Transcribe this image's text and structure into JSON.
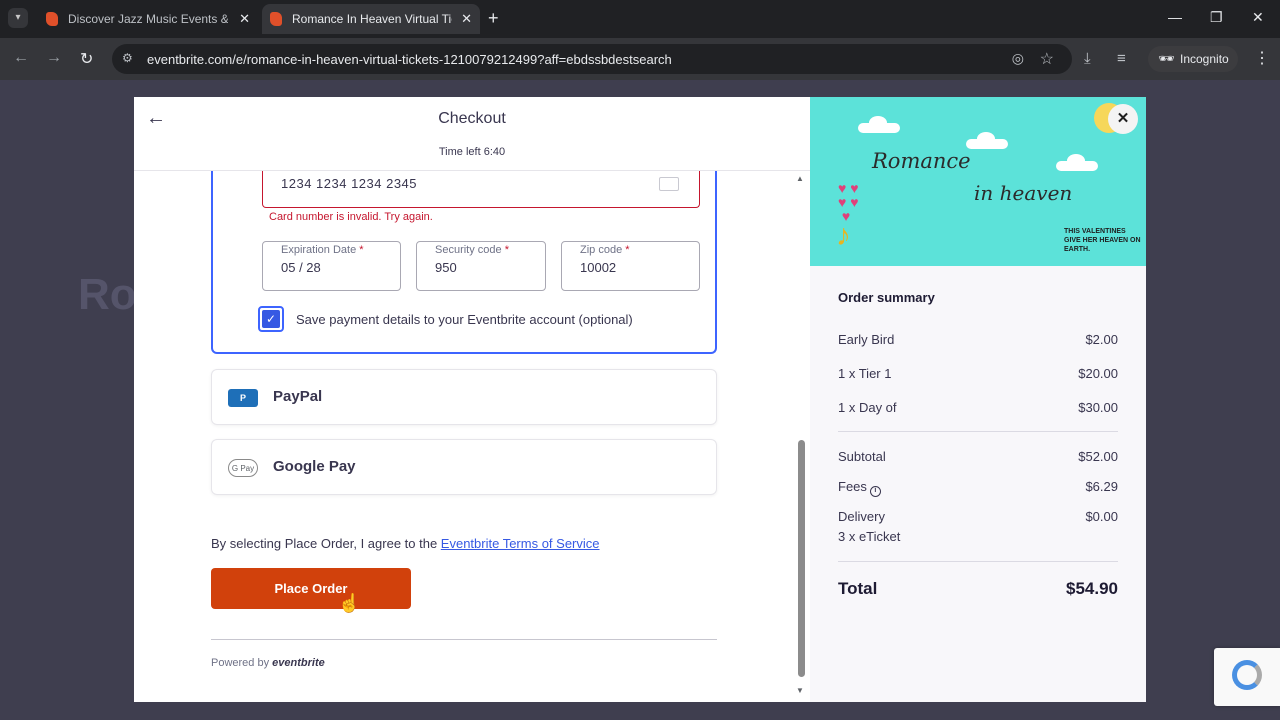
{
  "browser": {
    "tabs": [
      {
        "title": "Discover Jazz Music Events & A"
      },
      {
        "title": "Romance In Heaven Virtual Tick"
      }
    ],
    "url": "eventbrite.com/e/romance-in-heaven-virtual-tickets-1210079212499?aff=ebdssbdestsearch",
    "profile_label": "Incognito"
  },
  "checkout": {
    "title": "Checkout",
    "time_left": "Time left 6:40",
    "card_number": "1234  1234  1234  2345",
    "card_error": "Card number is invalid. Try again.",
    "expiration_label": "Expiration Date",
    "expiration_value": "05  /  28",
    "security_label": "Security code",
    "security_value": "950",
    "zip_label": "Zip code",
    "zip_value": "10002",
    "required_mark": "*",
    "save_label": "Save payment details to your Eventbrite account (optional)",
    "save_checked": true,
    "paypal_icon_text": "P",
    "paypal_label": "PayPal",
    "gpay_icon_text": "G Pay",
    "gpay_label": "Google Pay",
    "agree_text": "By selecting Place Order, I agree to the ",
    "agree_link": "Eventbrite Terms of Service",
    "place_order": "Place Order",
    "powered_by": "Powered by",
    "powered_brand": "eventbrite"
  },
  "banner": {
    "line1": "Romance",
    "line2": "in heaven",
    "tagline": "THIS VALENTINES GIVE HER HEAVEN ON EARTH."
  },
  "summary": {
    "title": "Order summary",
    "items": [
      {
        "label": "Early Bird",
        "amount": "$2.00"
      },
      {
        "label": "1 x Tier 1",
        "amount": "$20.00"
      },
      {
        "label": "1 x Day of",
        "amount": "$30.00"
      }
    ],
    "subtotal_label": "Subtotal",
    "subtotal": "$52.00",
    "fees_label": "Fees",
    "fees": "$6.29",
    "delivery_label": "Delivery",
    "delivery_detail": "3 x eTicket",
    "delivery": "$0.00",
    "total_label": "Total",
    "total": "$54.90"
  },
  "colors": {
    "accent_blue": "#3d64ff",
    "place_order": "#d1410c",
    "error": "#c5162e",
    "banner": "#5ce2d9"
  }
}
